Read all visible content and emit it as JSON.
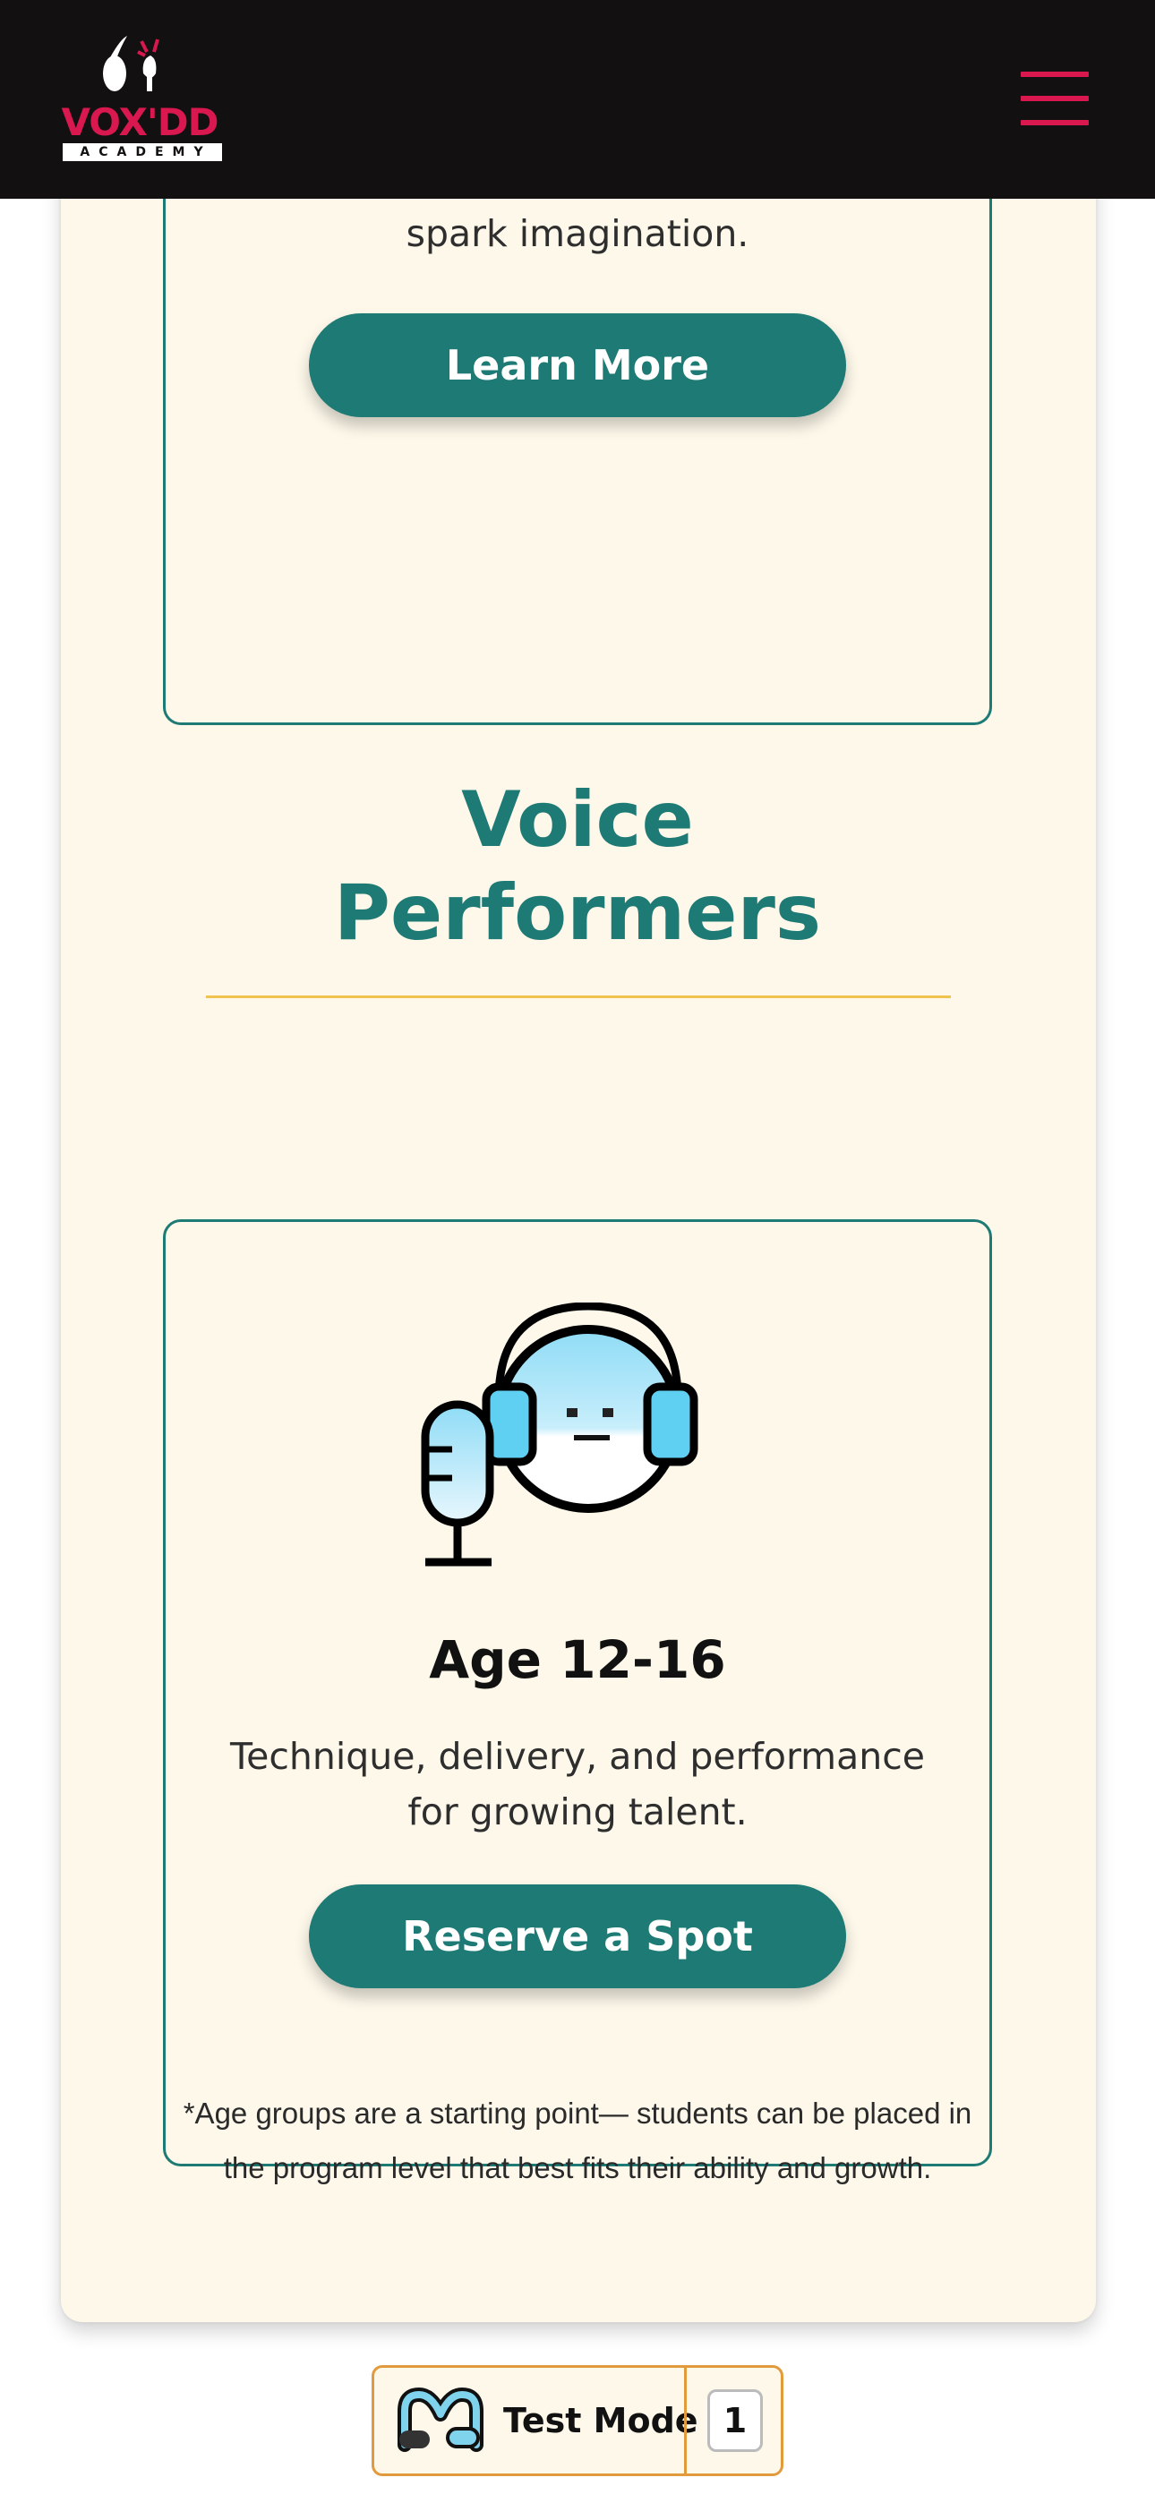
{
  "header": {
    "logo_wordmark": "VOX'DD",
    "logo_subtitle": "ACADEMY",
    "menu_icon": "hamburger-menu-icon",
    "brand_color": "#d8184f",
    "background": "#131012"
  },
  "top_card": {
    "partial_text": "spark imagination.",
    "button_label": "Learn More"
  },
  "section": {
    "title_line1": "Voice",
    "title_line2": "Performers",
    "accent_color": "#1e7a74",
    "divider_color": "#f0c24e"
  },
  "performer_card": {
    "icon": "voice-performer-headphones-microphone-icon",
    "age_title": "Age 12-16",
    "description_line1": "Technique, delivery, and performance",
    "description_line2": "for growing talent.",
    "button_label": "Reserve a Spot"
  },
  "footnote": {
    "line1": "*Age groups are a starting point— students can be placed in",
    "line2": "the program level that best fits their ability and growth."
  },
  "test_mode": {
    "label": "Test Mode",
    "count": "1",
    "icon": "m-logo-icon"
  }
}
